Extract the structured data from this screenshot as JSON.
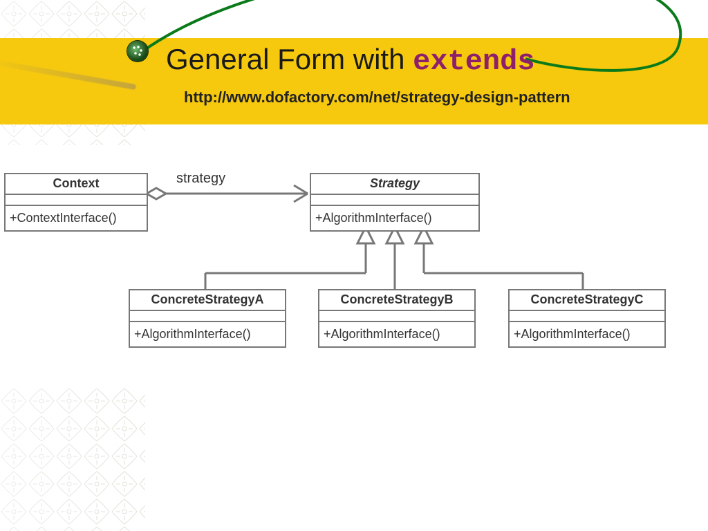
{
  "title": {
    "prefix": "General Form with ",
    "keyword": "extends"
  },
  "subtitle": "http://www.dofactory.com/net/strategy-design-pattern",
  "association_label": "strategy",
  "classes": {
    "context": {
      "name": "Context",
      "op": "+ContextInterface()"
    },
    "strategy": {
      "name": "Strategy",
      "op": "+AlgorithmInterface()"
    },
    "concreteA": {
      "name": "ConcreteStrategyA",
      "op": "+AlgorithmInterface()"
    },
    "concreteB": {
      "name": "ConcreteStrategyB",
      "op": "+AlgorithmInterface()"
    },
    "concreteC": {
      "name": "ConcreteStrategyC",
      "op": "+AlgorithmInterface()"
    }
  }
}
